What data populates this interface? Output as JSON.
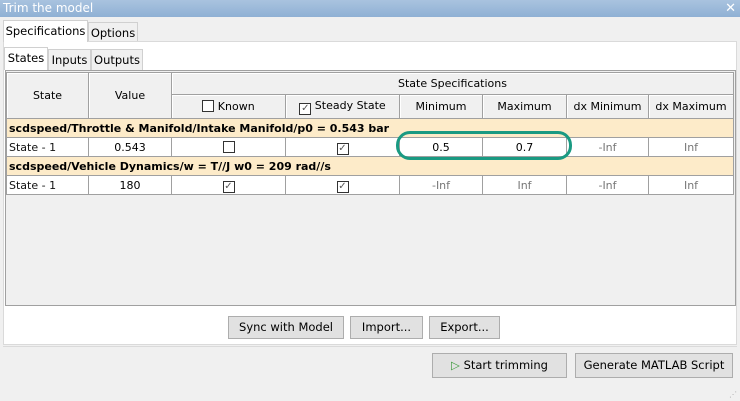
{
  "window": {
    "title": "Trim the model",
    "close_icon": "close-icon"
  },
  "main_tabs": [
    {
      "label": "Specifications",
      "selected": true
    },
    {
      "label": "Options",
      "selected": false
    }
  ],
  "sub_tabs": [
    {
      "label": "States",
      "selected": true
    },
    {
      "label": "Inputs",
      "selected": false
    },
    {
      "label": "Outputs",
      "selected": false
    }
  ],
  "table": {
    "headers": {
      "state": "State",
      "value": "Value",
      "group": "State Specifications",
      "known": "Known",
      "known_checked": false,
      "steady": "Steady State",
      "steady_checked": true,
      "min": "Minimum",
      "max": "Maximum",
      "dxmin": "dx Minimum",
      "dxmax": "dx Maximum"
    },
    "groups": [
      {
        "title": "scdspeed/Throttle & Manifold/Intake Manifold/p0 = 0.543 bar",
        "row": {
          "state": "State - 1",
          "value": "0.543",
          "known": false,
          "steady": true,
          "min": "0.5",
          "max": "0.7",
          "dxmin": "-Inf",
          "dxmax": "Inf"
        }
      },
      {
        "title": "scdspeed/Vehicle Dynamics/w = T//J w0 = 209 rad//s",
        "row": {
          "state": "State - 1",
          "value": "180",
          "known": true,
          "steady": true,
          "min": "-Inf",
          "max": "Inf",
          "dxmin": "-Inf",
          "dxmax": "Inf"
        }
      }
    ]
  },
  "buttons": {
    "sync": "Sync with Model",
    "import": "Import...",
    "export": "Export...",
    "start": "Start trimming",
    "generate": "Generate MATLAB Script"
  },
  "colors": {
    "highlight": "#1a9a82",
    "group_row": "#fdebc9"
  }
}
